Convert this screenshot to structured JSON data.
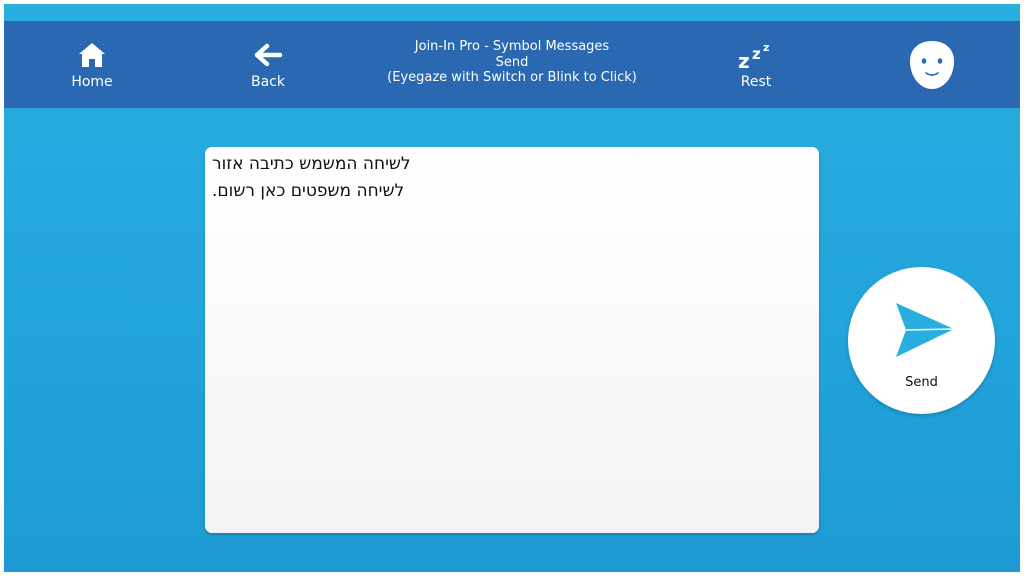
{
  "header": {
    "title_line1": "Join-In Pro - Symbol Messages",
    "title_line2": "Send",
    "title_line3": "(Eyegaze with Switch or Blink to Click)",
    "home_label": "Home",
    "back_label": "Back",
    "rest_label": "Rest",
    "icons": {
      "home": "home-icon",
      "back": "arrow-left-icon",
      "rest": "zzz-sleep-icon",
      "face": "face-icon"
    }
  },
  "message": {
    "line1": "לשיחה המשמש כתיבה אזור",
    "line2": "לשיחה משפטים כאן רשום."
  },
  "send": {
    "label": "Send",
    "icon": "paper-plane-icon"
  },
  "colors": {
    "header_bar": "#2a68b1",
    "background": "#22a4dc",
    "send_icon": "#29aee0"
  }
}
